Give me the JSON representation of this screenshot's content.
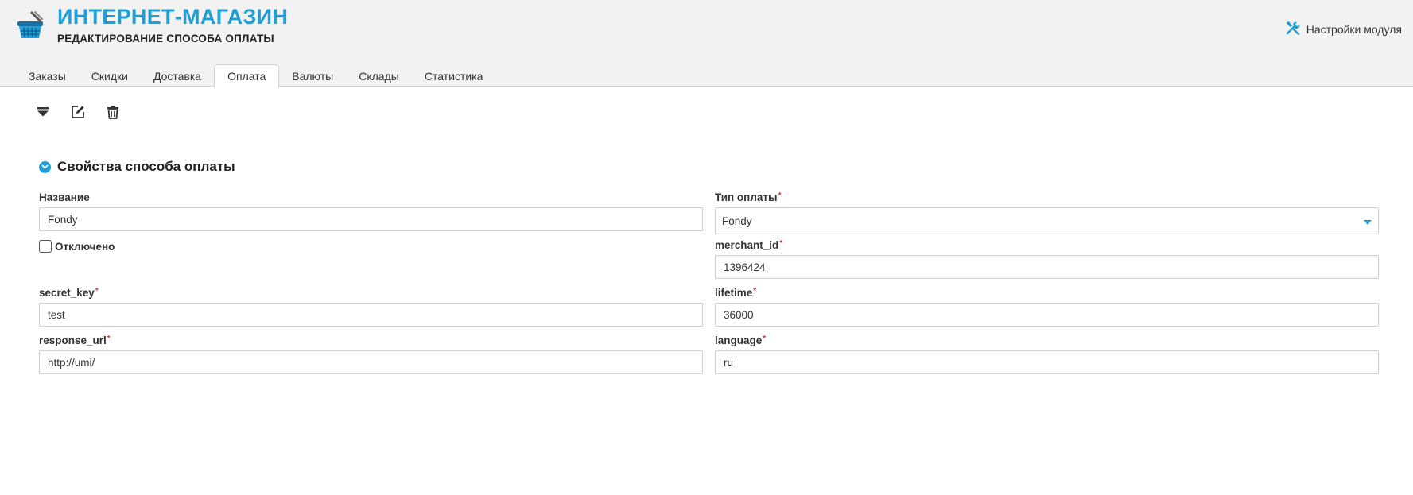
{
  "header": {
    "title": "ИНТЕРНЕТ-МАГАЗИН",
    "subtitle": "РЕДАКТИРОВАНИЕ СПОСОБА ОПЛАТЫ",
    "settings_label": "Настройки модуля",
    "logo_icon": "shopping-basket-icon",
    "settings_icon": "tools-icon"
  },
  "tabs": [
    {
      "label": "Заказы"
    },
    {
      "label": "Скидки"
    },
    {
      "label": "Доставка"
    },
    {
      "label": "Оплата",
      "active": true
    },
    {
      "label": "Валюты"
    },
    {
      "label": "Склады"
    },
    {
      "label": "Статистика"
    }
  ],
  "toolbar": {
    "icons": [
      "dropdown-icon",
      "edit-icon",
      "trash-icon"
    ]
  },
  "section": {
    "title": "Свойства способа оплаты"
  },
  "form": {
    "name": {
      "label": "Название",
      "value": "Fondy"
    },
    "disabled": {
      "label": "Отключено",
      "checked": false
    },
    "payment_type": {
      "label": "Тип оплаты",
      "value": "Fondy"
    },
    "merchant_id": {
      "label": "merchant_id",
      "value": "1396424"
    },
    "secret_key": {
      "label": "secret_key",
      "value": "test"
    },
    "lifetime": {
      "label": "lifetime",
      "value": "36000"
    },
    "response_url": {
      "label": "response_url",
      "value": "http://umi/"
    },
    "language": {
      "label": "language",
      "value": "ru"
    },
    "required_mark": "*"
  },
  "colors": {
    "accent": "#1e9fd8",
    "header_bg": "#f2f2f2"
  }
}
